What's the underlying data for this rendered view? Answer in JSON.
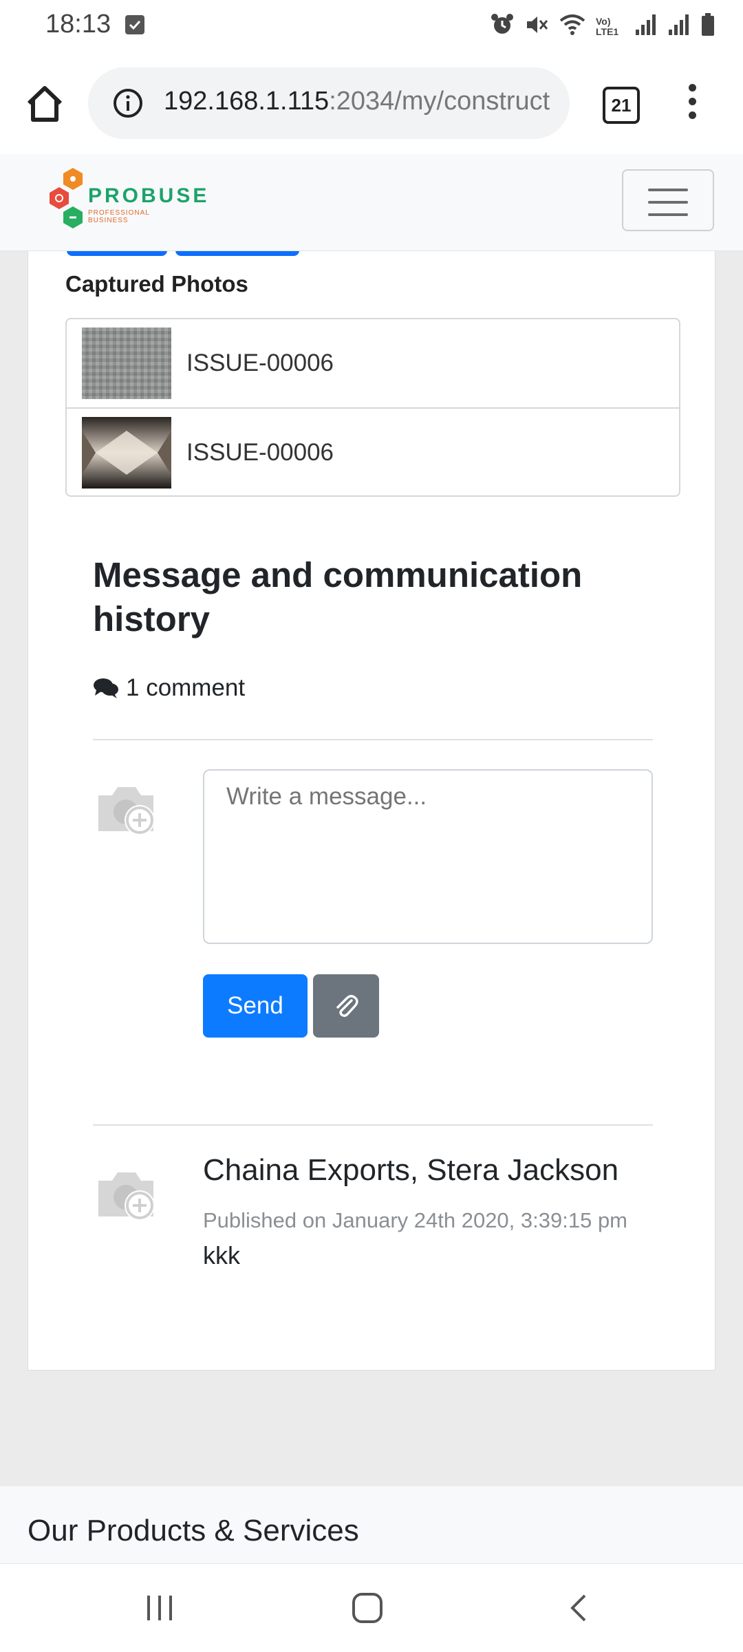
{
  "status_bar": {
    "time": "18:13",
    "icons": [
      "check-notification-icon",
      "alarm-icon",
      "mute-icon",
      "wifi-icon",
      "volte-icon",
      "signal-icon",
      "signal-icon",
      "battery-icon"
    ],
    "volte_label": "Vo) LTE1"
  },
  "browser": {
    "url_host": "192.168.1.115",
    "url_path": ":2034/my/construct",
    "tab_count": "21"
  },
  "site": {
    "logo_name": "PROBUSE",
    "logo_tagline": "PROFESSIONAL BUSINESS"
  },
  "photos": {
    "label": "Captured Photos",
    "items": [
      {
        "name": "ISSUE-00006"
      },
      {
        "name": "ISSUE-00006"
      }
    ]
  },
  "messages": {
    "title": "Message and communication history",
    "comment_count": "1 comment",
    "input_placeholder": "Write a message...",
    "send_label": "Send",
    "comments": [
      {
        "author": "Chaina Exports, Stera Jackson",
        "date": "Published on January 24th 2020, 3:39:15 pm",
        "body": "kkk"
      }
    ]
  },
  "footer": {
    "title": "Our Products & Services"
  },
  "colors": {
    "primary": "#0d7bff",
    "secondary": "#6c757d",
    "logo_green": "#1ba36a",
    "logo_orange": "#e06a2c"
  }
}
